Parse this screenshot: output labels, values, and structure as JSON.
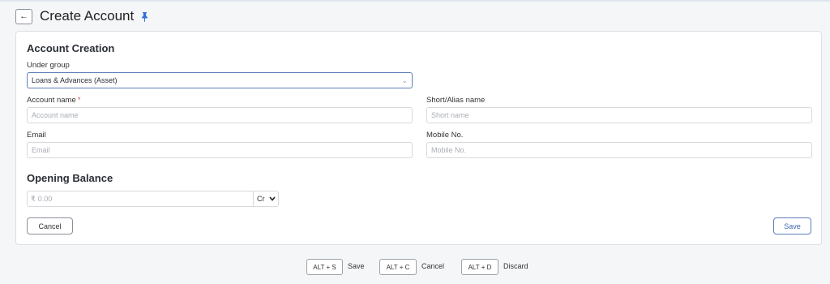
{
  "header": {
    "back_icon": "←",
    "title": "Create Account",
    "pin_icon": "pin-icon"
  },
  "form": {
    "section_title": "Account Creation",
    "under_group": {
      "label": "Under group",
      "value": "Loans & Advances (Asset)"
    },
    "account_name": {
      "label": "Account name",
      "required_mark": "*",
      "placeholder": "Account name"
    },
    "alias_name": {
      "label": "Short/Alias name",
      "placeholder": "Short name"
    },
    "email": {
      "label": "Email",
      "placeholder": "Email"
    },
    "mobile": {
      "label": "Mobile No.",
      "placeholder": "Mobile No."
    },
    "opening_balance": {
      "title": "Opening Balance",
      "currency_symbol": "₹",
      "placeholder": "0.00",
      "cr_dr_value": "Cr"
    },
    "cancel_label": "Cancel",
    "save_label": "Save"
  },
  "shortcuts": [
    {
      "keys": "ALT + S",
      "label": "Save"
    },
    {
      "keys": "ALT + C",
      "label": "Cancel"
    },
    {
      "keys": "ALT + D",
      "label": "Discard"
    }
  ],
  "colors": {
    "accent": "#3e67b0",
    "required": "#e24c4b",
    "pin": "#2f6fd6"
  }
}
